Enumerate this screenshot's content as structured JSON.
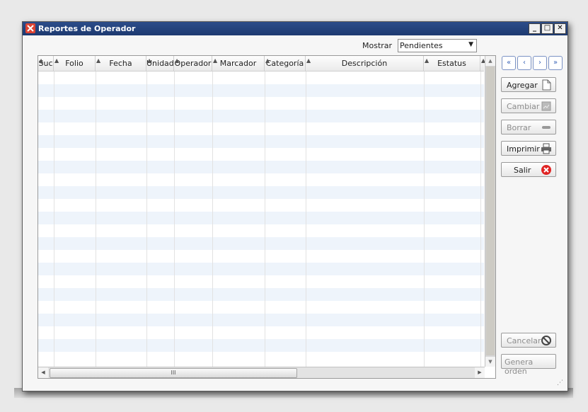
{
  "window": {
    "title": "Reportes de Operador",
    "controls": {
      "minimize": "_",
      "maximize": "□",
      "close": "✕"
    }
  },
  "filter": {
    "label": "Mostrar",
    "selected": "Pendientes"
  },
  "table": {
    "columns": [
      "Suc",
      "Folio",
      "Fecha",
      "Unidad",
      "Operador",
      "Marcador",
      "Categoría",
      "Descripción",
      "Estatus"
    ],
    "rows": []
  },
  "nav": {
    "first": "«",
    "prev": "‹",
    "next": "›",
    "last": "»"
  },
  "actions": {
    "agregar": "Agregar",
    "cambiar": "Cambiar",
    "borrar": "Borrar",
    "imprimir": "Imprimir",
    "salir": "Salir",
    "cancelar": "Cancelar",
    "genera_orden": "Genera orden"
  },
  "scrollbar": {
    "thumb_grip": "III"
  },
  "colors": {
    "titlebar": "#1d3a70",
    "stripe": "#eef4fb",
    "nav_accent": "#3a64b8",
    "exit": "#e02424"
  }
}
